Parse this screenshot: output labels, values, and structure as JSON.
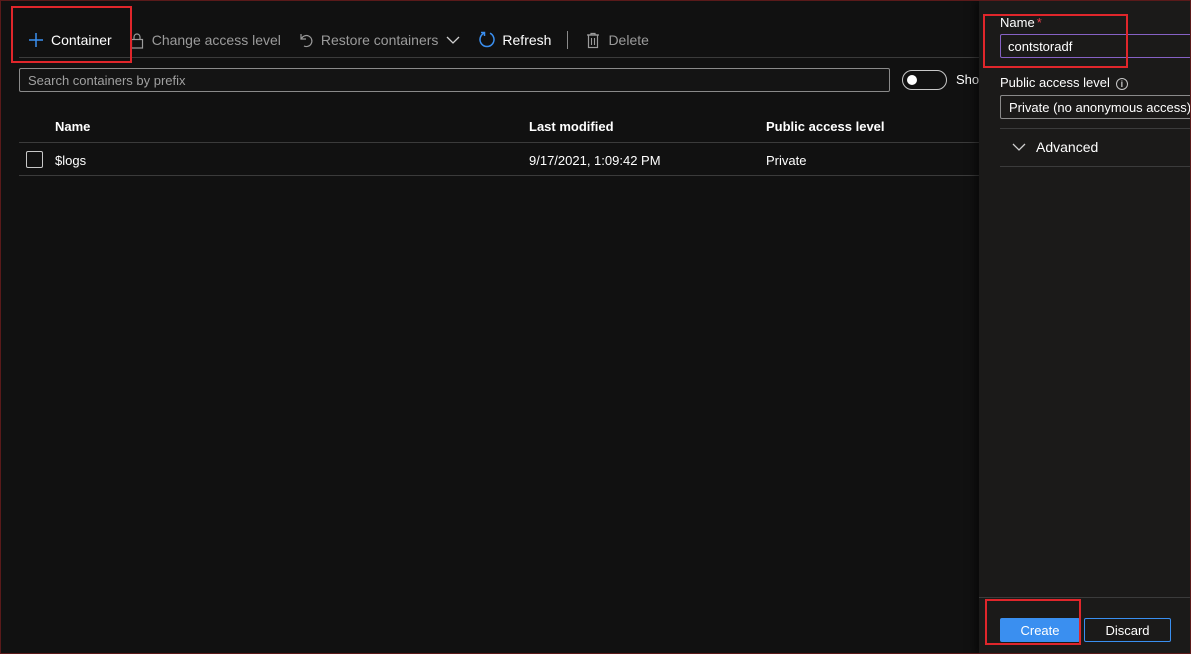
{
  "toolbar": {
    "container_label": "Container",
    "change_access_label": "Change access level",
    "restore_label": "Restore containers",
    "refresh_label": "Refresh",
    "delete_label": "Delete"
  },
  "search": {
    "placeholder": "Search containers by prefix",
    "value": ""
  },
  "toggle": {
    "label": "Sho"
  },
  "table": {
    "columns": [
      "Name",
      "Last modified",
      "Public access level"
    ],
    "rows": [
      {
        "name": "$logs",
        "last_modified": "9/17/2021, 1:09:42 PM",
        "access": "Private"
      }
    ]
  },
  "panel": {
    "name_label": "Name",
    "required_mark": "*",
    "name_value": "contstoradf",
    "access_label": "Public access level",
    "info_glyph": "i",
    "access_value": "Private (no anonymous access)",
    "advanced_label": "Advanced",
    "create_label": "Create",
    "discard_label": "Discard"
  },
  "colors": {
    "background": "#111111",
    "panel": "#1b1a19",
    "accent": "#3a8ff0",
    "annotation": "#e0262b"
  },
  "icons": {
    "container": "plus-icon",
    "change_access": "lock-icon",
    "restore": "undo-icon",
    "restore_menu": "chevron-down-icon",
    "refresh": "refresh-icon",
    "delete": "trash-icon",
    "advanced": "chevron-down-icon"
  }
}
